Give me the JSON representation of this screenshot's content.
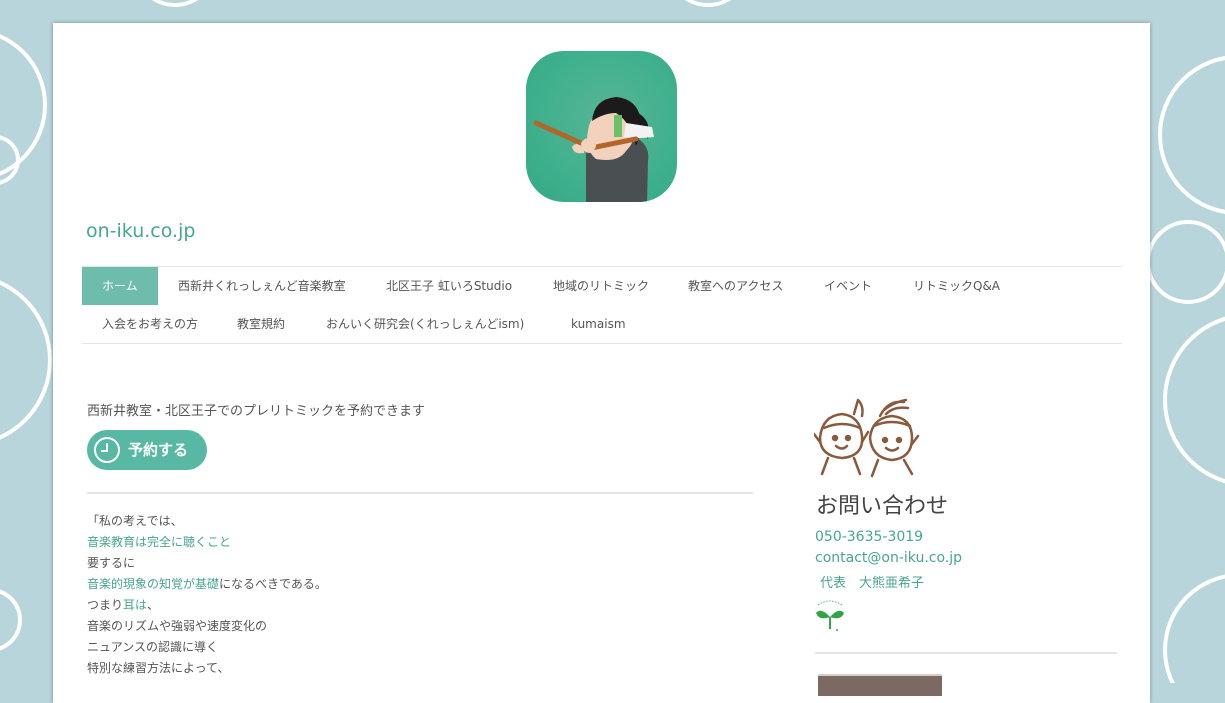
{
  "site": {
    "title": "on-iku.co.jp",
    "colors": {
      "background": "#b9d5dc",
      "accent": "#47a593",
      "nav_active": "#6dbcac",
      "button": "#58b8a4"
    }
  },
  "nav": {
    "items": [
      {
        "label": "ホーム",
        "active": true
      },
      {
        "label": "西新井くれっしぇんど音楽教室"
      },
      {
        "label": "北区王子 虹いろStudio"
      },
      {
        "label": "地域のリトミック"
      },
      {
        "label": "教室へのアクセス"
      },
      {
        "label": "イベント"
      },
      {
        "label": "リトミックQ&A"
      },
      {
        "label": "入会をお考えの方"
      },
      {
        "label": "教室規約"
      },
      {
        "label": "おんいく研究会(くれっしぇんどism)"
      },
      {
        "label": "kumaism"
      }
    ]
  },
  "main": {
    "intro": "西新井教室・北区王子でのプレリトミックを予約できます",
    "reserve_label": "予約する",
    "reserve_icon": "clock-icon",
    "lines": [
      {
        "text": "「私の考えでは、"
      },
      {
        "text": "音楽教育は完全に聴くこと",
        "highlight": true
      },
      {
        "text": "要するに"
      },
      {
        "parts": [
          {
            "text": "音楽的現象の知覚が基礎",
            "highlight": true
          },
          {
            "text": "になるべきである。"
          }
        ]
      },
      {
        "parts": [
          {
            "text": "つまり"
          },
          {
            "text": "耳は",
            "highlight": true
          },
          {
            "text": "、"
          }
        ]
      },
      {
        "text": "音楽のリズムや強弱や速度変化の"
      },
      {
        "text": "ニュアンスの認識に導く"
      },
      {
        "text": "特別な練習方法によって、"
      }
    ]
  },
  "sidebar": {
    "contact_title": "お問い合わせ",
    "tel": "050-3635-3019",
    "email": "contact@on-iku.co.jp",
    "representative": "代表　大熊亜希子",
    "icons": [
      "mascot-icon",
      "sprout-icon"
    ]
  }
}
